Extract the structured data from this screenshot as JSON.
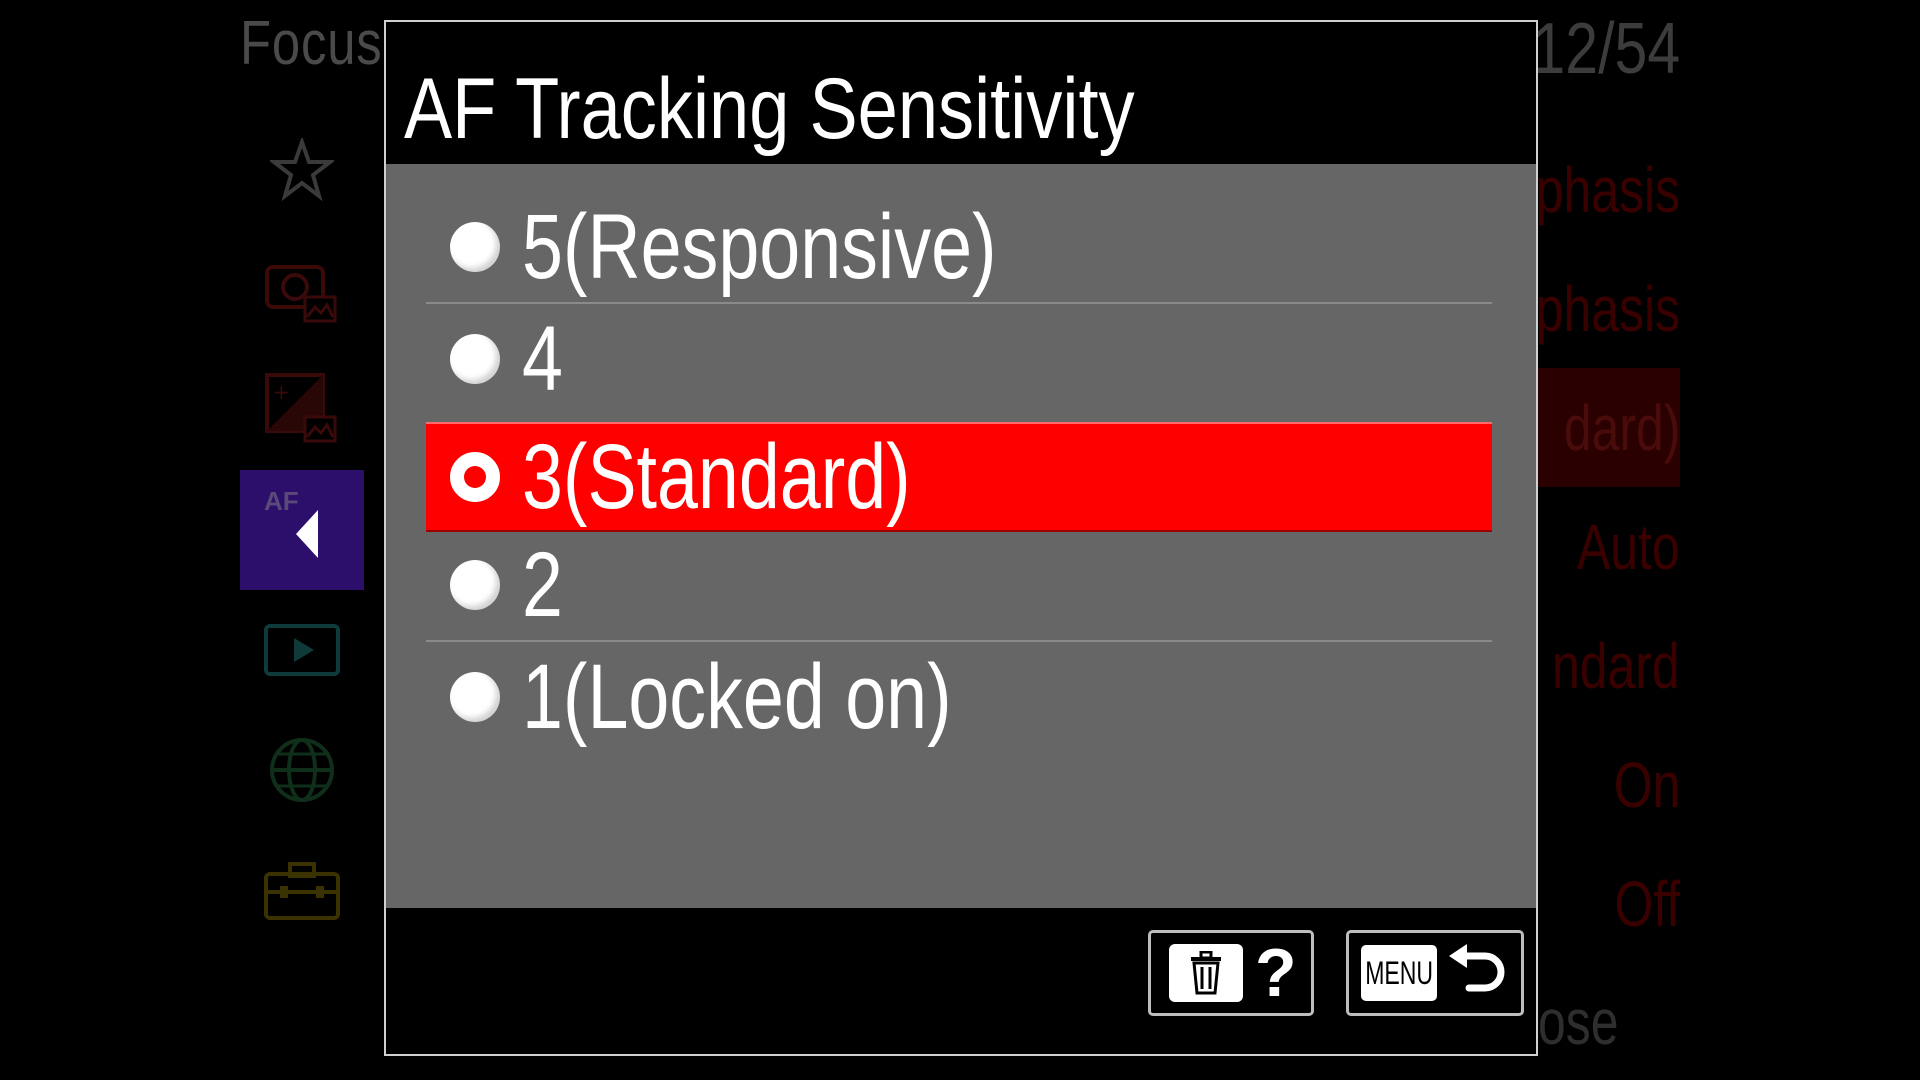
{
  "background_menu": {
    "title": "Focus",
    "page_indicator": "12/54",
    "sidebar": {
      "icons": [
        "star-icon",
        "camera-photo-icon",
        "exposure-icon",
        "af-mf-icon",
        "playback-icon",
        "network-globe-icon",
        "toolbox-icon"
      ],
      "active_index": 3
    },
    "values": [
      "phasis",
      "phasis",
      "dard)",
      "Auto",
      "ndard",
      "On",
      "Off"
    ],
    "selected_value_index": 2,
    "bottom_text": "ose"
  },
  "dialog": {
    "title": "AF Tracking Sensitivity",
    "options": [
      {
        "label": "5(Responsive)"
      },
      {
        "label": "4"
      },
      {
        "label": "3(Standard)"
      },
      {
        "label": "2"
      },
      {
        "label": "1(Locked on)"
      }
    ],
    "selected_index": 2
  },
  "footer": {
    "help_button": {
      "icon": "trash-icon",
      "label": "?"
    },
    "back_button": {
      "menu_label": "MENU",
      "icon": "return-arrow-icon"
    }
  },
  "colors": {
    "selection_red": "#ff0000",
    "options_bg": "#666666",
    "active_tab_purple": "#2b0f6a"
  }
}
